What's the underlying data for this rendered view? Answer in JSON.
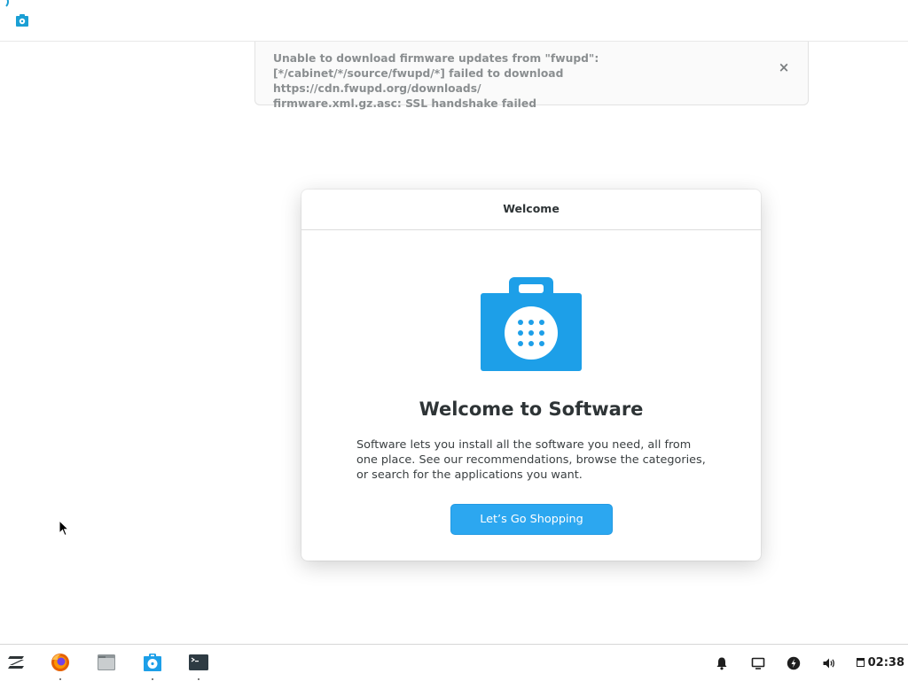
{
  "window": {
    "app_icon": "software-bag-icon"
  },
  "notification": {
    "message": "Unable to download firmware updates from \"fwupd\":\n[*/cabinet/*/source/fwupd/*] failed to download https://cdn.fwupd.org/downloads/\nfirmware.xml.gz.asc: SSL handshake failed",
    "close_label": "×"
  },
  "dialog": {
    "title": "Welcome",
    "heading": "Welcome to Software",
    "body": "Software lets you install all the software you need, all from one place. See our recommendations, browse the categories, or search for the applications you want.",
    "button_label": "Let’s Go Shopping",
    "accent_color": "#2ca7f0"
  },
  "taskbar": {
    "apps": [
      {
        "name": "zorin-menu-icon"
      },
      {
        "name": "firefox-icon"
      },
      {
        "name": "files-icon"
      },
      {
        "name": "software-icon"
      },
      {
        "name": "terminal-icon"
      }
    ],
    "tray": [
      "bell-icon",
      "screen-icon",
      "power-icon",
      "volume-icon"
    ],
    "clock": "02:38"
  }
}
